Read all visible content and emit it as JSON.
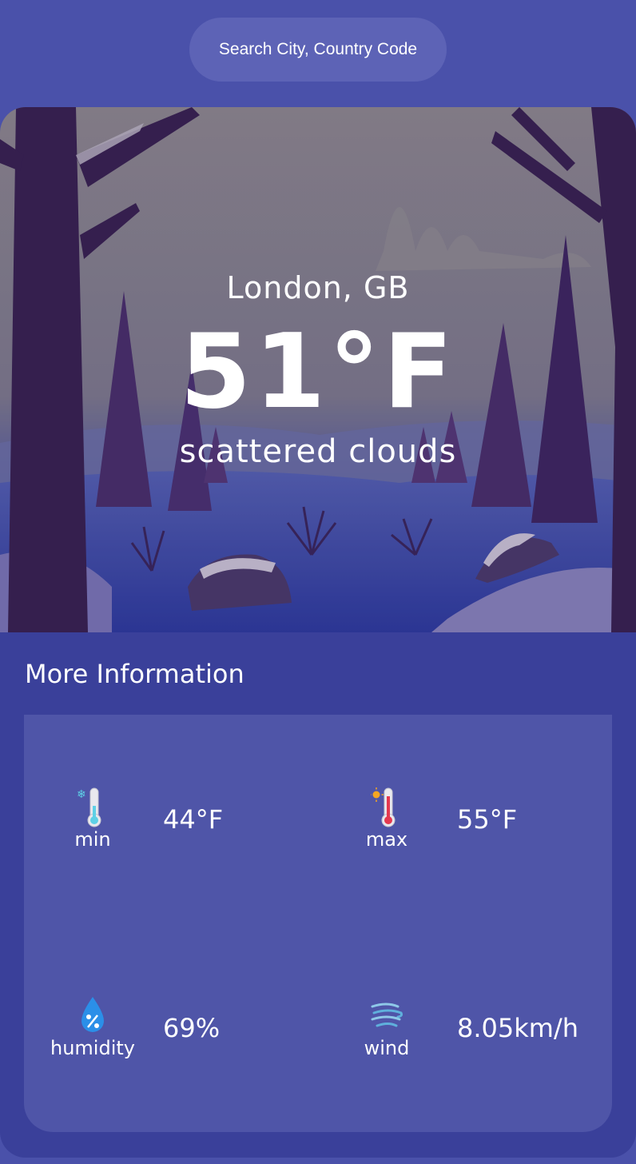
{
  "search": {
    "placeholder": "Search City, Country Code"
  },
  "weather": {
    "location": "London, GB",
    "temperature": "51°F",
    "description": "scattered clouds"
  },
  "more_info": {
    "title": "More Information",
    "stats": [
      {
        "label": "min",
        "value": "44°F",
        "icon": "thermometer-cold-icon"
      },
      {
        "label": "max",
        "value": "55°F",
        "icon": "thermometer-hot-icon"
      },
      {
        "label": "humidity",
        "value": "69%",
        "icon": "humidity-drop-icon"
      },
      {
        "label": "wind",
        "value": "8.05km/h",
        "icon": "wind-icon"
      }
    ]
  },
  "colors": {
    "page_background": "#4a51aa",
    "card_background": "#3a409a",
    "panel_background": "#4f55a8",
    "search_background": "#5d63b6"
  }
}
